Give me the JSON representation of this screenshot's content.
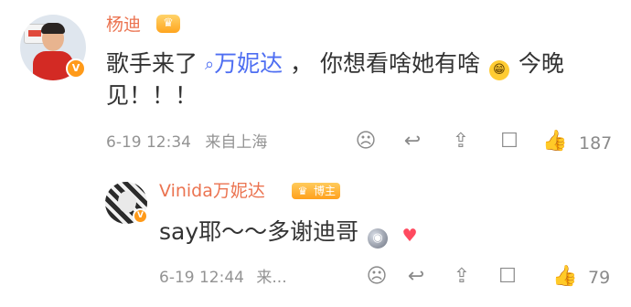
{
  "comment": {
    "author": "杨迪",
    "text_prefix": "歌手来了",
    "mention_label": "万妮达",
    "text_middle": "， 你想看啥她有啥",
    "text_suffix": "今晚",
    "text_line2": "见！！！",
    "timestamp": "6-19 12:34",
    "location": "来自上海",
    "likes": "187"
  },
  "reply": {
    "author": "Vinida万妮达",
    "badge": "博主",
    "text": "say耶～～多谢迪哥",
    "timestamp": "6-19 12:44",
    "location_truncated": "来...",
    "likes": "79"
  },
  "icons": {
    "verified": "v-verified-icon",
    "vip": "crown-vip-icon",
    "search": "search-icon",
    "emoji_smile": "grin-emoji-icon",
    "emoji_disco": "disco-ball-emoji-icon",
    "emoji_heart": "heart-emoji-icon",
    "dislike": "unhappy-face-icon",
    "reply": "reply-icon",
    "share": "share-icon",
    "comment": "comment-icon",
    "like": "thumb-up-icon"
  },
  "colors": {
    "name": "#eb7350",
    "mention": "#4e6ef2",
    "text": "#333333",
    "meta": "#939393"
  }
}
